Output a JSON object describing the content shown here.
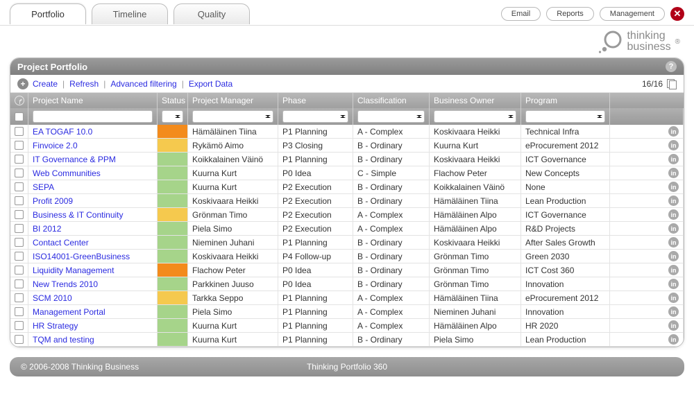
{
  "tabs": {
    "portfolio": "Portfolio",
    "timeline": "Timeline",
    "quality": "Quality"
  },
  "topLinks": {
    "email": "Email",
    "reports": "Reports",
    "management": "Management"
  },
  "brand": {
    "line1": "thinking",
    "line2": "business"
  },
  "panel": {
    "title": "Project Portfolio"
  },
  "toolbar": {
    "create": "Create",
    "refresh": "Refresh",
    "filter": "Advanced filtering",
    "export": "Export Data",
    "count": "16/16"
  },
  "columns": {
    "name": "Project Name",
    "status": "Status",
    "pm": "Project Manager",
    "phase": "Phase",
    "cls": "Classification",
    "owner": "Business Owner",
    "prog": "Program"
  },
  "statusColors": {
    "green": "#a6d48a",
    "orange": "#f38b1c",
    "yellow": "#f5c94e"
  },
  "rows": [
    {
      "name": "EA TOGAF 10.0",
      "status": "orange",
      "pm": "Hämäläinen Tiina",
      "phase": "P1 Planning",
      "cls": "A - Complex",
      "owner": "Koskivaara Heikki",
      "prog": "Technical Infra"
    },
    {
      "name": "Finvoice 2.0",
      "status": "yellow",
      "pm": "Rykämö Aimo",
      "phase": "P3 Closing",
      "cls": "B - Ordinary",
      "owner": "Kuurna Kurt",
      "prog": "eProcurement 2012"
    },
    {
      "name": "IT Governance & PPM",
      "status": "green",
      "pm": "Koikkalainen Väinö",
      "phase": "P1 Planning",
      "cls": "B - Ordinary",
      "owner": "Koskivaara Heikki",
      "prog": "ICT Governance"
    },
    {
      "name": "Web Communities",
      "status": "green",
      "pm": "Kuurna Kurt",
      "phase": "P0 Idea",
      "cls": "C - Simple",
      "owner": "Flachow Peter",
      "prog": "New Concepts"
    },
    {
      "name": "SEPA",
      "status": "green",
      "pm": "Kuurna Kurt",
      "phase": "P2 Execution",
      "cls": "B - Ordinary",
      "owner": "Koikkalainen Väinö",
      "prog": "None"
    },
    {
      "name": "Profit 2009",
      "status": "green",
      "pm": "Koskivaara Heikki",
      "phase": "P2 Execution",
      "cls": "B - Ordinary",
      "owner": "Hämäläinen Tiina",
      "prog": "Lean Production"
    },
    {
      "name": "Business & IT Continuity",
      "status": "yellow",
      "pm": "Grönman Timo",
      "phase": "P2 Execution",
      "cls": "A - Complex",
      "owner": "Hämäläinen Alpo",
      "prog": "ICT Governance"
    },
    {
      "name": "BI 2012",
      "status": "green",
      "pm": "Piela Simo",
      "phase": "P2 Execution",
      "cls": "A - Complex",
      "owner": "Hämäläinen Alpo",
      "prog": "R&D Projects"
    },
    {
      "name": "Contact Center",
      "status": "green",
      "pm": "Nieminen Juhani",
      "phase": "P1 Planning",
      "cls": "B - Ordinary",
      "owner": "Koskivaara Heikki",
      "prog": "After Sales Growth"
    },
    {
      "name": "ISO14001-GreenBusiness",
      "status": "green",
      "pm": "Koskivaara Heikki",
      "phase": "P4 Follow-up",
      "cls": "B - Ordinary",
      "owner": "Grönman Timo",
      "prog": "Green 2030"
    },
    {
      "name": "Liquidity Management",
      "status": "orange",
      "pm": "Flachow Peter",
      "phase": "P0 Idea",
      "cls": "B - Ordinary",
      "owner": "Grönman Timo",
      "prog": "ICT Cost 360"
    },
    {
      "name": "New Trends 2010",
      "status": "green",
      "pm": "Parkkinen Juuso",
      "phase": "P0 Idea",
      "cls": "B - Ordinary",
      "owner": "Grönman Timo",
      "prog": "Innovation"
    },
    {
      "name": "SCM 2010",
      "status": "yellow",
      "pm": "Tarkka Seppo",
      "phase": "P1 Planning",
      "cls": "A - Complex",
      "owner": "Hämäläinen Tiina",
      "prog": "eProcurement 2012"
    },
    {
      "name": "Management Portal",
      "status": "green",
      "pm": "Piela Simo",
      "phase": "P1 Planning",
      "cls": "A - Complex",
      "owner": "Nieminen Juhani",
      "prog": "Innovation"
    },
    {
      "name": "HR Strategy",
      "status": "green",
      "pm": "Kuurna Kurt",
      "phase": "P1 Planning",
      "cls": "A - Complex",
      "owner": "Hämäläinen Alpo",
      "prog": "HR 2020"
    },
    {
      "name": "TQM and testing",
      "status": "green",
      "pm": "Kuurna Kurt",
      "phase": "P1 Planning",
      "cls": "B - Ordinary",
      "owner": "Piela Simo",
      "prog": "Lean Production"
    }
  ],
  "footer": {
    "left": "© 2006-2008 Thinking Business",
    "center": "Thinking Portfolio 360"
  }
}
